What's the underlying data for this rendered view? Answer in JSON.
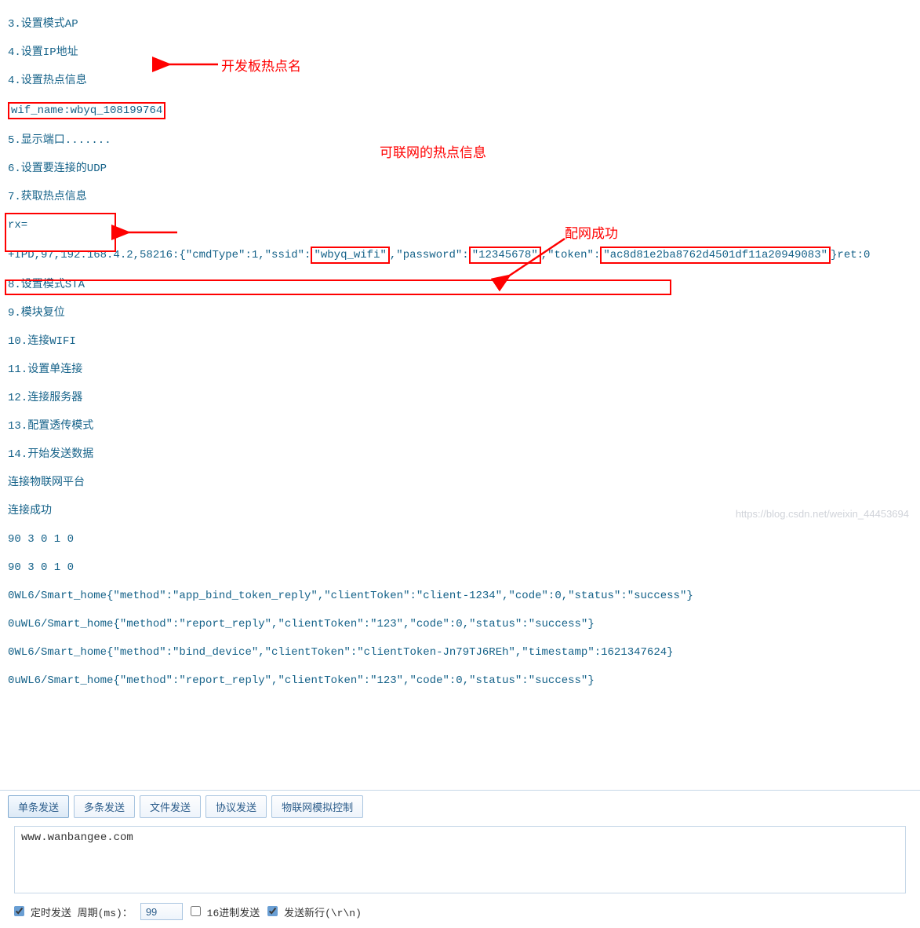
{
  "log": {
    "l3": "3.设置模式AP",
    "l4": "4.设置IP地址",
    "l5cut": "4.设置热点信息",
    "wifi_name_prefix": "wif_name:",
    "wifi_name_value": "wbyq_108199764",
    "l5show": "5.显示端口.......",
    "l6": "6.设置要连接的UDP",
    "l7": "7.获取热点信息",
    "rx": "rx=",
    "ipd_pre": "+IPD,97,192.168.4.2,58216:{\"cmdType\":1,\"ssid\":",
    "ipd_ssid": "\"wbyq_wifi\"",
    "ipd_comma1": ",\"password\":",
    "ipd_pass": "\"12345678\"",
    "ipd_comma2": ",\"token\":",
    "ipd_token": "\"ac8d81e2ba8762d4501df11a20949083\"",
    "ipd_post": "}ret:0",
    "l8": "8.设置模式STA",
    "l9": "9.模块复位",
    "l10": "10.连接WIFI",
    "l11": "11.设置单连接",
    "l12": "12.连接服务器",
    "l13": "13.配置透传模式",
    "l14": "14.开始发送数据",
    "l14b": "连接物联网平台",
    "l14c": "连接成功",
    "nums1": "90 3 0 1 0",
    "nums2": "90 3 0 1 0",
    "resp1": "0WL6/Smart_home{\"method\":\"app_bind_token_reply\",\"clientToken\":\"client-1234\",\"code\":0,\"status\":\"success\"}",
    "resp2": "0uWL6/Smart_home{\"method\":\"report_reply\",\"clientToken\":\"123\",\"code\":0,\"status\":\"success\"}",
    "resp3": "0WL6/Smart_home{\"method\":\"bind_device\",\"clientToken\":\"clientToken-Jn79TJ6REh\",\"timestamp\":1621347624}",
    "resp4": "0uWL6/Smart_home{\"method\":\"report_reply\",\"clientToken\":\"123\",\"code\":0,\"status\":\"success\"}"
  },
  "annotations": {
    "hotspot_name": "开发板热点名",
    "hotspot_info": "可联网的热点信息",
    "net_success": "配网成功"
  },
  "tabs": {
    "single": "单条发送",
    "multi": "多条发送",
    "file": "文件发送",
    "proto": "协议发送",
    "iot": "物联网模拟控制"
  },
  "send_text": "www.wanbangee.com",
  "options": {
    "timed": "定时发送 周期(ms)：",
    "period": "99",
    "hex": "16进制发送",
    "newline": "发送新行(\\r\\n)"
  },
  "watermark": "https://blog.csdn.net/weixin_44453694"
}
